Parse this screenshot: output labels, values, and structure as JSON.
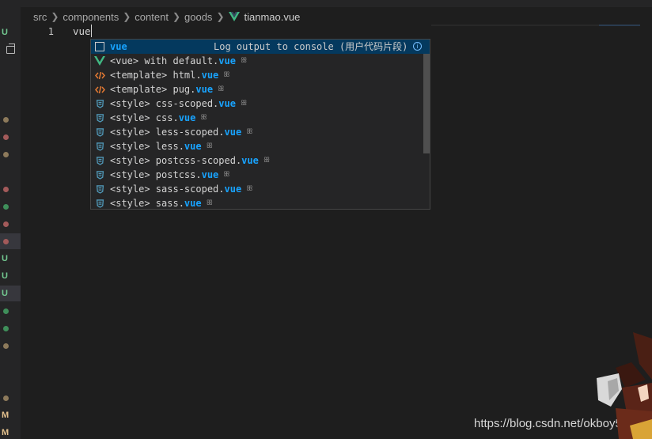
{
  "breadcrumb": {
    "items": [
      "src",
      "components",
      "content",
      "goods"
    ],
    "file": "tianmao.vue"
  },
  "editor": {
    "line_number": "1",
    "code": "vue"
  },
  "suggest": {
    "detail": "Log output to console (用户代码片段)",
    "info_icon": "i",
    "items": [
      {
        "prefix": "",
        "match": "vue",
        "icon": "snippet-icon"
      },
      {
        "prefix": "<vue> with default.",
        "match": "vue",
        "icon": "vue-icon"
      },
      {
        "prefix": "<template> html.",
        "match": "vue",
        "icon": "html-icon"
      },
      {
        "prefix": "<template> pug.",
        "match": "vue",
        "icon": "html-icon"
      },
      {
        "prefix": "<style> css-scoped.",
        "match": "vue",
        "icon": "css-icon"
      },
      {
        "prefix": "<style> css.",
        "match": "vue",
        "icon": "css-icon"
      },
      {
        "prefix": "<style> less-scoped.",
        "match": "vue",
        "icon": "css-icon"
      },
      {
        "prefix": "<style> less.",
        "match": "vue",
        "icon": "css-icon"
      },
      {
        "prefix": "<style> postcss-scoped.",
        "match": "vue",
        "icon": "css-icon"
      },
      {
        "prefix": "<style> postcss.",
        "match": "vue",
        "icon": "css-icon"
      },
      {
        "prefix": "<style> sass-scoped.",
        "match": "vue",
        "icon": "css-icon"
      },
      {
        "prefix": "<style> sass.",
        "match": "vue",
        "icon": "css-icon"
      }
    ],
    "item_mark": "ꕥ"
  },
  "gutter": {
    "items": [
      {
        "type": "letter",
        "text": "U",
        "color": "#73c991"
      },
      {
        "type": "icon",
        "text": "",
        "color": "#bbbbbb"
      },
      {
        "type": "dot",
        "color": "#8d7a5b"
      },
      {
        "type": "dot",
        "color": "#a35a5a"
      },
      {
        "type": "dot",
        "color": "#8d7a5b"
      },
      {
        "type": "dot",
        "color": "#a35a5a"
      },
      {
        "type": "dot",
        "color": "#3f8f5a"
      },
      {
        "type": "dot",
        "color": "#a35a5a"
      },
      {
        "type": "dot",
        "color": "#a35a5a"
      },
      {
        "type": "letter",
        "text": "U",
        "color": "#73c991"
      },
      {
        "type": "letter",
        "text": "U",
        "color": "#73c991"
      },
      {
        "type": "letter",
        "text": "U",
        "color": "#73c991"
      },
      {
        "type": "dot",
        "color": "#3f8f5a"
      },
      {
        "type": "dot",
        "color": "#3f8f5a"
      },
      {
        "type": "dot",
        "color": "#8d7a5b"
      },
      {
        "type": "dot",
        "color": "#8d7a5b"
      },
      {
        "type": "letter",
        "text": "M",
        "color": "#e2c08d"
      },
      {
        "type": "letter",
        "text": "M",
        "color": "#e2c08d"
      }
    ]
  },
  "watermark": "https://blog.csdn.net/okboy519",
  "colors": {
    "accent": "#18a3ff",
    "vue_green": "#41b883",
    "html_orange": "#e37933",
    "css_blue": "#519aba"
  }
}
